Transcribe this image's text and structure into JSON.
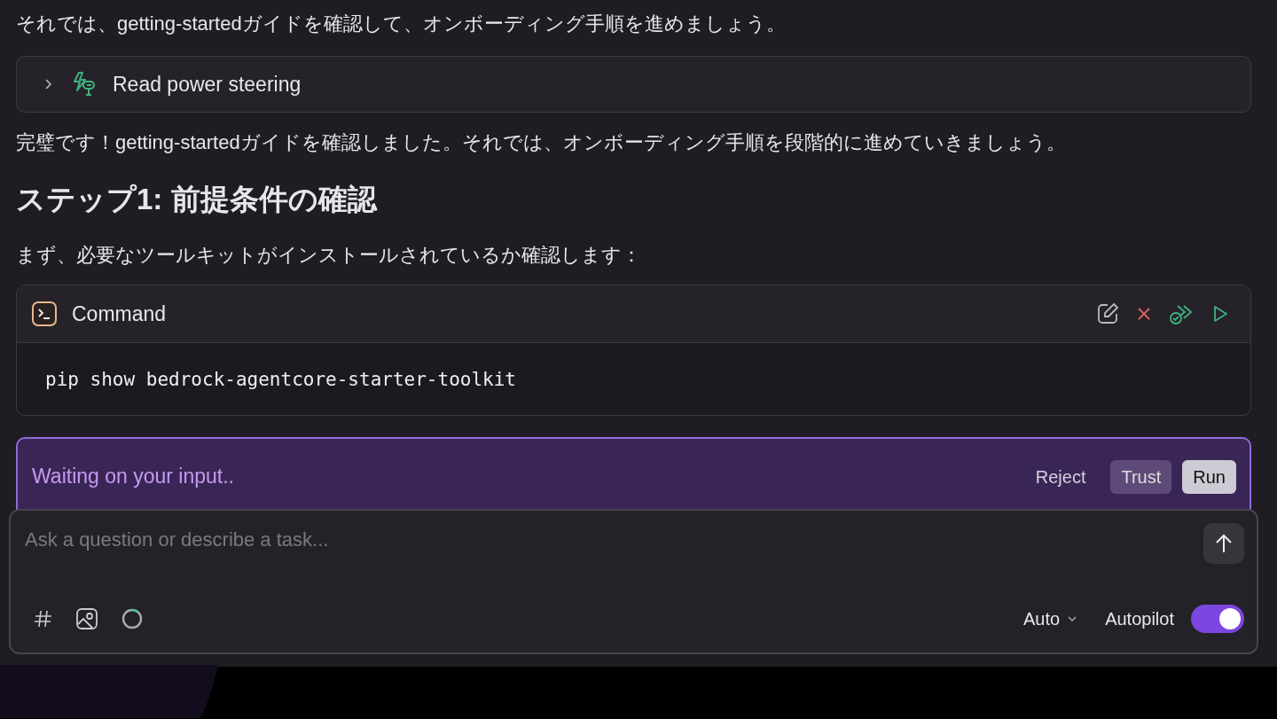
{
  "intro_text": "それでは、getting-startedガイドを確認して、オンボーディング手順を進めましょう。",
  "tool_step": {
    "label": "Read power steering",
    "expanded": false
  },
  "message": "完璧です！getting-startedガイドを確認しました。それでは、オンボーディング手順を段階的に進めていきましょう。",
  "heading": "ステップ1: 前提条件の確認",
  "lead": "まず、必要なツールキットがインストールされているか確認します：",
  "command": {
    "title": "Command",
    "code": "pip show bedrock-agentcore-starter-toolkit"
  },
  "approval": {
    "status": "Waiting on your input..",
    "buttons": [
      {
        "label": "Reject",
        "kind": "plain"
      },
      {
        "label": "Trust",
        "kind": "secondary"
      },
      {
        "label": "Run",
        "kind": "primary"
      }
    ]
  },
  "composer": {
    "placeholder": "Ask a question or describe a task...",
    "mode": "Auto",
    "autopilot_label": "Autopilot",
    "autopilot_on": true
  }
}
